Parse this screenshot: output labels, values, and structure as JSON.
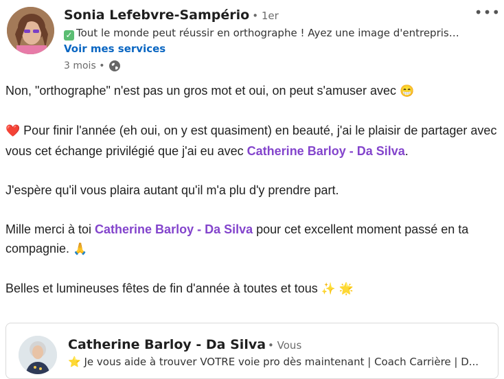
{
  "header": {
    "author_name": "Sonia Lefebvre-Sampério",
    "degree": "• 1er",
    "tagline": "Tout le monde peut réussir en orthographe ! Ayez une image d'entreprise irréprochable",
    "services_link": "Voir mes services",
    "time_ago": "3 mois •",
    "more_icon": "more-horizontal-icon",
    "visibility_icon": "globe-icon"
  },
  "post": {
    "line1": "Non, \"orthographe\" n'est pas un gros mot et oui, on peut s'amuser avec",
    "line1_emoji": "😁",
    "para2_emoji": "❤️",
    "para2_text": " Pour finir l'année (eh oui, on y est quasiment) en beauté, j'ai le plaisir de partager avec vous cet échange privilégié que j'ai eu avec ",
    "para2_mention": "Catherine Barloy - Da Silva",
    "para2_end": ".",
    "para3": "J'espère qu'il vous plaira autant qu'il m'a plu d'y prendre part.",
    "para4_start": "Mille merci à toi ",
    "para4_mention": "Catherine Barloy - Da Silva",
    "para4_end": " pour cet excellent moment passé en ta compagnie.",
    "para4_emoji": "🙏",
    "para5": "Belles et lumineuses fêtes de fin d'année à toutes et tous",
    "para5_emoji": "✨ 🌟"
  },
  "shared_card": {
    "name": "Catherine Barloy - Da Silva",
    "you_label": "• Vous",
    "tagline_emoji": "⭐",
    "tagline": "Je vous aide à trouver VOTRE voie pro dès maintenant | Coach Carrière | D..."
  },
  "colors": {
    "mention": "#8344cc",
    "link": "#0a66c2"
  }
}
